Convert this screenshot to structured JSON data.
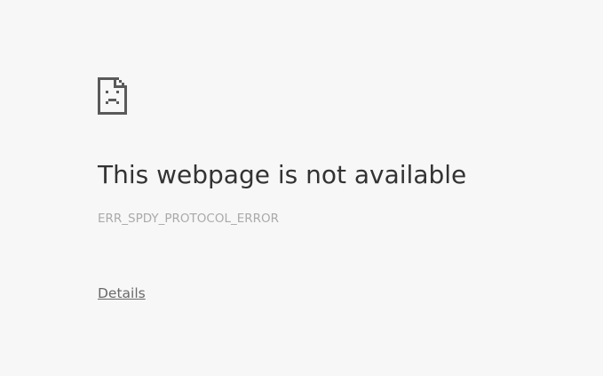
{
  "error_page": {
    "icon": "sad-page-icon",
    "title": "This webpage is not available",
    "error_code": "ERR_SPDY_PROTOCOL_ERROR",
    "details_link": "Details"
  },
  "colors": {
    "background": "#f7f7f7",
    "title": "#333333",
    "error_code": "#aaaaaa",
    "details_link": "#696969",
    "icon": "#5a5a5a"
  }
}
